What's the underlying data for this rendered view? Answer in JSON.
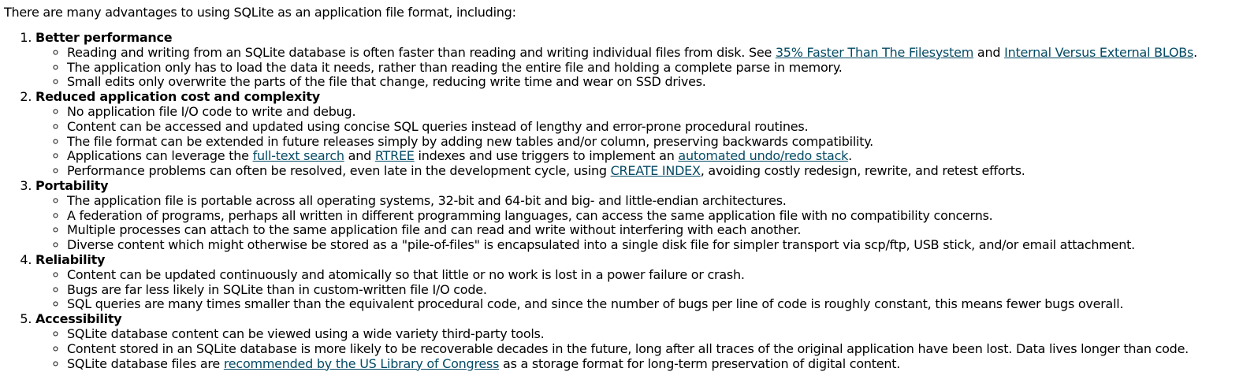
{
  "intro": "There are many advantages to using SQLite as an application file format, including:",
  "sections": [
    {
      "title": "Better performance",
      "items": [
        [
          {
            "t": "Reading and writing from an SQLite database is often faster than reading and writing individual files from disk. See "
          },
          {
            "t": "35% Faster Than The Filesystem",
            "link": true
          },
          {
            "t": " and "
          },
          {
            "t": "Internal Versus External BLOBs",
            "link": true
          },
          {
            "t": "."
          }
        ],
        [
          {
            "t": "The application only has to load the data it needs, rather than reading the entire file and holding a complete parse in memory."
          }
        ],
        [
          {
            "t": "Small edits only overwrite the parts of the file that change, reducing write time and wear on SSD drives."
          }
        ]
      ]
    },
    {
      "title": "Reduced application cost and complexity",
      "items": [
        [
          {
            "t": "No application file I/O code to write and debug."
          }
        ],
        [
          {
            "t": "Content can be accessed and updated using concise SQL queries instead of lengthy and error-prone procedural routines."
          }
        ],
        [
          {
            "t": "The file format can be extended in future releases simply by adding new tables and/or column, preserving backwards compatibility."
          }
        ],
        [
          {
            "t": "Applications can leverage the "
          },
          {
            "t": "full-text search",
            "link": true
          },
          {
            "t": " and "
          },
          {
            "t": "RTREE",
            "link": true
          },
          {
            "t": " indexes and use triggers to implement an "
          },
          {
            "t": "automated undo/redo stack",
            "link": true
          },
          {
            "t": "."
          }
        ],
        [
          {
            "t": "Performance problems can often be resolved, even late in the development cycle, using "
          },
          {
            "t": "CREATE INDEX",
            "link": true
          },
          {
            "t": ", avoiding costly redesign, rewrite, and retest efforts."
          }
        ]
      ]
    },
    {
      "title": "Portability",
      "items": [
        [
          {
            "t": "The application file is portable across all operating systems, 32-bit and 64-bit and big- and little-endian architectures."
          }
        ],
        [
          {
            "t": "A federation of programs, perhaps all written in different programming languages, can access the same application file with no compatibility concerns."
          }
        ],
        [
          {
            "t": "Multiple processes can attach to the same application file and can read and write without interfering with each another."
          }
        ],
        [
          {
            "t": "Diverse content which might otherwise be stored as a \"pile-of-files\" is encapsulated into a single disk file for simpler transport via scp/ftp, USB stick, and/or email attachment."
          }
        ]
      ]
    },
    {
      "title": "Reliability",
      "items": [
        [
          {
            "t": "Content can be updated continuously and atomically so that little or no work is lost in a power failure or crash."
          }
        ],
        [
          {
            "t": "Bugs are far less likely in SQLite than in custom-written file I/O code."
          }
        ],
        [
          {
            "t": "SQL queries are many times smaller than the equivalent procedural code, and since the number of bugs per line of code is roughly constant, this means fewer bugs overall."
          }
        ]
      ]
    },
    {
      "title": "Accessibility",
      "items": [
        [
          {
            "t": "SQLite database content can be viewed using a wide variety third-party tools."
          }
        ],
        [
          {
            "t": "Content stored in an SQLite database is more likely to be recoverable decades in the future, long after all traces of the original application have been lost. Data lives longer than code."
          }
        ],
        [
          {
            "t": "SQLite database files are "
          },
          {
            "t": "recommended by the US Library of Congress",
            "link": true
          },
          {
            "t": " as a storage format for long-term preservation of digital content."
          }
        ]
      ]
    }
  ],
  "colors": {
    "text": "#000000",
    "link": "#044a64",
    "background": "#ffffff"
  }
}
